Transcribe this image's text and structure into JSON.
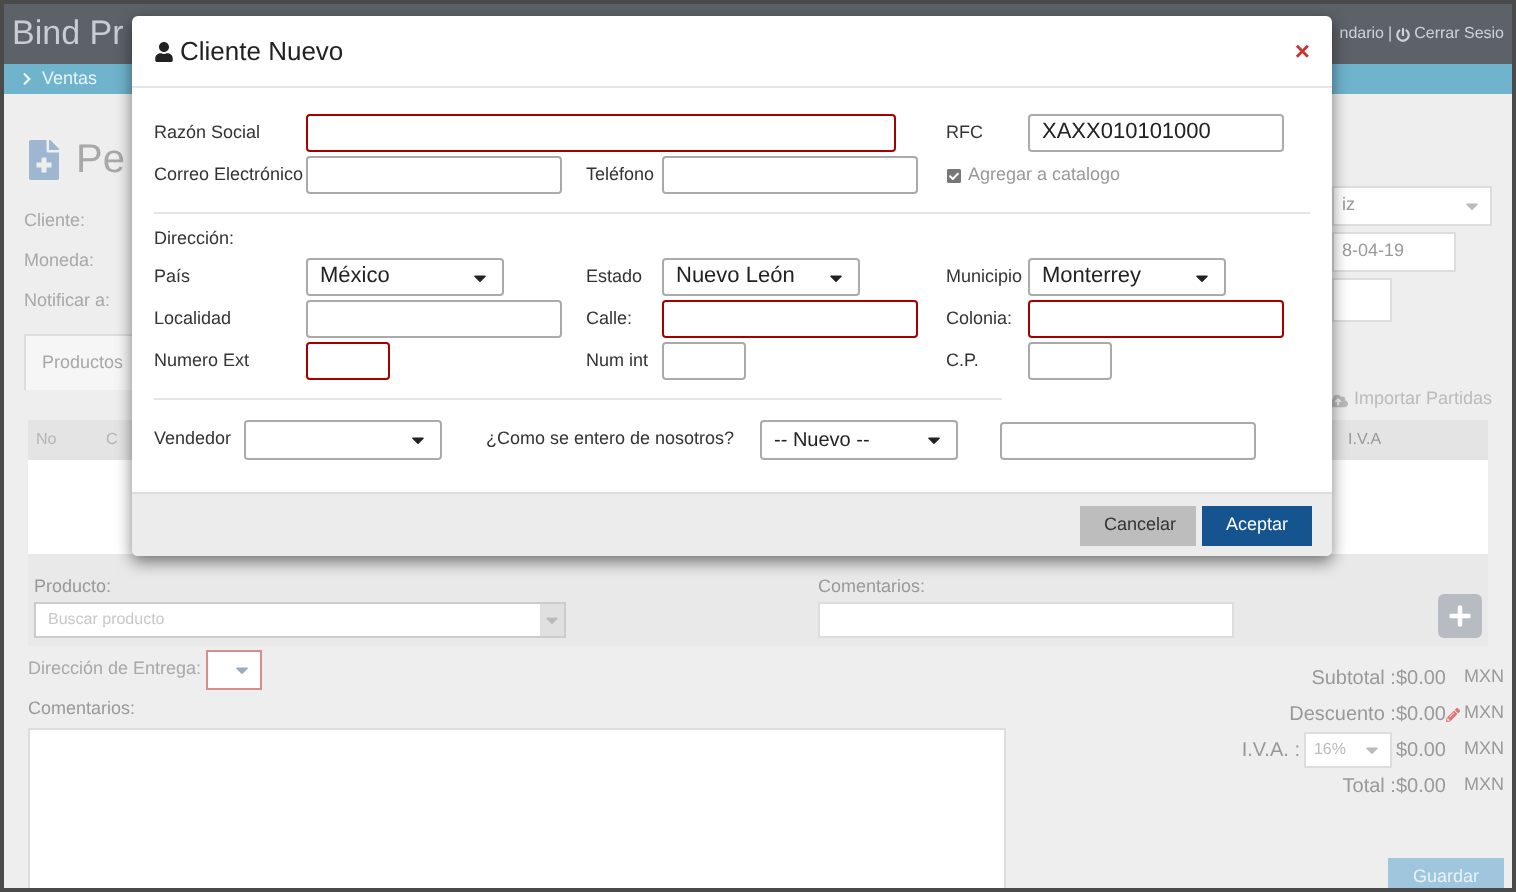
{
  "app": {
    "brand": "Bind Pr",
    "user_menu": "ndario",
    "separator": "|",
    "logout": "Cerrar Sesio",
    "breadcrumb": "Ventas",
    "page_title": "Pe",
    "form_labels": [
      "Cliente:",
      "Moneda:",
      "Notificar a:"
    ],
    "client_select": "iz",
    "date_field": "8-04-19",
    "tab": "Productos",
    "import_link": "Importar Partidas",
    "table_columns": [
      "No",
      "C",
      "I.V.A"
    ],
    "product_label": "Producto:",
    "product_placeholder": "Buscar producto",
    "line_comment_label": "Comentarios:",
    "delivery_label": "Dirección de Entrega:",
    "delivery_invalid": true,
    "comments_label": "Comentarios:",
    "totals": [
      {
        "kind": "plain",
        "label": "Subtotal :",
        "value": "$0.00",
        "currency": "MXN"
      },
      {
        "kind": "discount",
        "label": "Descuento :",
        "value": "$0.00",
        "currency": "MXN"
      },
      {
        "kind": "tax",
        "label": "I.V.A. :",
        "rate": "16%",
        "value": "$0.00",
        "currency": "MXN"
      },
      {
        "kind": "plain",
        "label": "Total :",
        "value": "$0.00",
        "currency": "MXN"
      }
    ],
    "save_button": "Guardar"
  },
  "modal": {
    "title": "Cliente Nuevo",
    "close": "×",
    "rows": [
      [
        {
          "kind": "input",
          "label": "Razón Social",
          "invalid": true
        },
        "",
        {
          "kind": "input",
          "label": "RFC",
          "value": "XAXX010101000",
          "invalid": false
        }
      ],
      [
        {
          "kind": "input",
          "label": "Correo Electrónico",
          "invalid": false
        },
        {
          "kind": "input",
          "label": "Teléfono",
          "invalid": false
        },
        {
          "kind": "checkbox",
          "label": "Agregar a catalogo",
          "checked": true
        }
      ]
    ],
    "address_heading": "Dirección:",
    "address_rows": [
      [
        {
          "kind": "select",
          "label": "País",
          "value": "México",
          "invalid": false
        },
        {
          "kind": "select",
          "label": "Estado",
          "value": "Nuevo León",
          "invalid": false
        },
        {
          "kind": "select",
          "label": "Municipio",
          "value": "Monterrey",
          "invalid": false
        }
      ],
      [
        {
          "kind": "input",
          "label": "Localidad",
          "invalid": false
        },
        {
          "kind": "input",
          "label": "Calle:",
          "invalid": true
        },
        {
          "kind": "input",
          "label": "Colonia:",
          "invalid": true
        }
      ],
      [
        {
          "kind": "short",
          "label": "Numero Ext",
          "invalid": true
        },
        {
          "kind": "short",
          "label": "Num int",
          "invalid": false
        },
        {
          "kind": "short",
          "label": "C.P.",
          "invalid": false
        }
      ]
    ],
    "vendor_label": "Vendedor",
    "source_label": "¿Como se entero de nosotros?",
    "source_value": "-- Nuevo --",
    "buttons": [
      {
        "kind": "secondary",
        "label": "Cancelar"
      },
      {
        "kind": "primary",
        "label": "Aceptar"
      }
    ]
  }
}
